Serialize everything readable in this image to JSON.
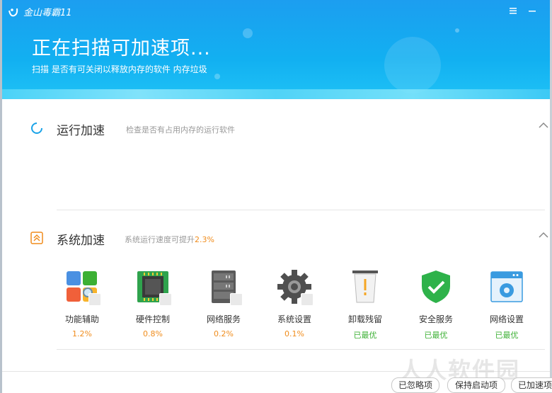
{
  "app": {
    "title": "金山毒霸11"
  },
  "header": {
    "title": "正在扫描可加速项...",
    "subtitle": "扫描 是否有可关闭以释放内存的软件 内存垃圾"
  },
  "sections": [
    {
      "title": "运行加速",
      "desc": "检查是否有占用内存的运行软件",
      "pct": ""
    },
    {
      "title": "系统加速",
      "desc": "系统运行速度可提升",
      "pct": "2.3%"
    }
  ],
  "items": [
    {
      "label": "功能辅助",
      "value": "1.2%",
      "status": "orange",
      "icon": "feature-assist-icon"
    },
    {
      "label": "硬件控制",
      "value": "0.8%",
      "status": "orange",
      "icon": "chip-icon"
    },
    {
      "label": "网络服务",
      "value": "0.2%",
      "status": "orange",
      "icon": "server-icon"
    },
    {
      "label": "系统设置",
      "value": "0.1%",
      "status": "orange",
      "icon": "gear-icon"
    },
    {
      "label": "卸载残留",
      "value": "已最优",
      "status": "green",
      "icon": "trash-warning-icon"
    },
    {
      "label": "安全服务",
      "value": "已最优",
      "status": "green",
      "icon": "shield-check-icon"
    },
    {
      "label": "网络设置",
      "value": "已最优",
      "status": "green",
      "icon": "network-settings-icon"
    }
  ],
  "footer": {
    "ignored": "已忽略项",
    "keep_startup": "保持启动项",
    "accelerated": "已加速项"
  },
  "watermark": "人人软件园",
  "colors": {
    "accent_blue": "#1c9ef0",
    "orange": "#f08c1c",
    "green": "#3cb034"
  }
}
